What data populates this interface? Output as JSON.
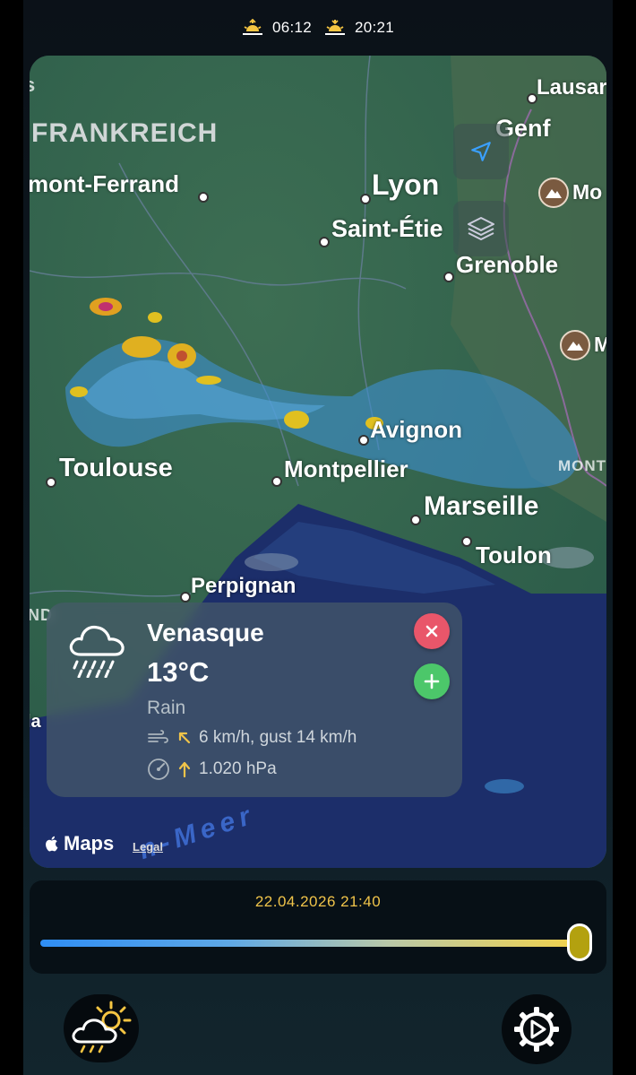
{
  "sun": {
    "sunrise_icon": "sunrise-icon",
    "sunrise": "06:12",
    "sunset_icon": "sunset-icon",
    "sunset": "20:21"
  },
  "map": {
    "cities": [
      "s",
      "FRANKREICH",
      "mont-Ferrand",
      "Lyon",
      "Saint-Étie",
      "Genf",
      "Lausar",
      "Grenoble",
      "Mo",
      "M",
      "Avignon",
      "Toulouse",
      "Montpellier",
      "MONT",
      "Marseille",
      "Toulon",
      "Perpignan",
      "ND",
      "la"
    ],
    "sea_label": "n-Meer",
    "attribution": "Maps",
    "legal": "Legal"
  },
  "card": {
    "location": "Venasque",
    "temperature": "13°C",
    "condition": "Rain",
    "wind": "6 km/h, gust 14 km/h",
    "pressure": "1.020 hPa"
  },
  "timeline": {
    "date": "22.04.2026 21:40",
    "position": 1.0
  },
  "colors": {
    "accent_yellow": "#f0c44a",
    "close_red": "#e9566a",
    "add_green": "#4cc76a",
    "slider_start": "#2f8ef5",
    "slider_end": "#f1d24d"
  }
}
